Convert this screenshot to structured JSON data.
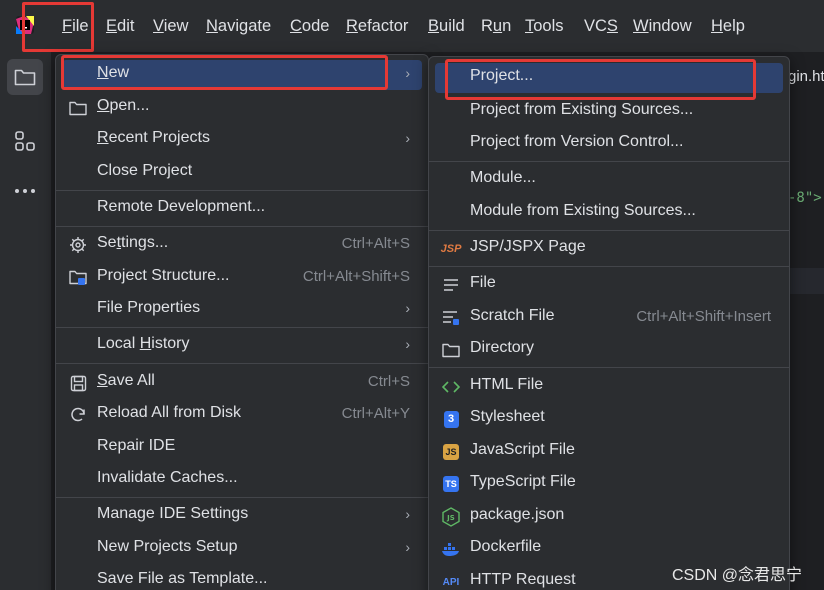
{
  "menubar": {
    "items": [
      {
        "pre": "",
        "mn": "F",
        "post": "ile"
      },
      {
        "pre": "",
        "mn": "E",
        "post": "dit"
      },
      {
        "pre": "",
        "mn": "V",
        "post": "iew"
      },
      {
        "pre": "",
        "mn": "N",
        "post": "avigate"
      },
      {
        "pre": "",
        "mn": "C",
        "post": "ode"
      },
      {
        "pre": "",
        "mn": "R",
        "post": "efactor"
      },
      {
        "pre": "",
        "mn": "B",
        "post": "uild"
      },
      {
        "pre": "R",
        "mn": "u",
        "post": "n"
      },
      {
        "pre": "",
        "mn": "T",
        "post": "ools"
      },
      {
        "pre": "VC",
        "mn": "S",
        "post": ""
      },
      {
        "pre": "",
        "mn": "W",
        "post": "indow"
      },
      {
        "pre": "",
        "mn": "H",
        "post": "elp"
      }
    ]
  },
  "file_menu": {
    "new": {
      "pre": "",
      "mn": "N",
      "post": "ew"
    },
    "open": {
      "pre": "",
      "mn": "O",
      "post": "pen..."
    },
    "recent_projects": {
      "pre": "",
      "mn": "R",
      "post": "ecent Projects"
    },
    "close_project": "Close Project",
    "remote_development": "Remote Development...",
    "settings": {
      "pre": "Se",
      "mn": "t",
      "post": "tings...",
      "shortcut": "Ctrl+Alt+S"
    },
    "project_structure": {
      "label": "Project Structure...",
      "shortcut": "Ctrl+Alt+Shift+S"
    },
    "file_properties": "File Properties",
    "local_history": {
      "pre": "Local ",
      "mn": "H",
      "post": "istory"
    },
    "save_all": {
      "pre": "",
      "mn": "S",
      "post": "ave All",
      "shortcut": "Ctrl+S"
    },
    "reload": {
      "label": "Reload All from Disk",
      "shortcut": "Ctrl+Alt+Y"
    },
    "repair_ide": "Repair IDE",
    "invalidate_caches": "Invalidate Caches...",
    "manage_ide_settings": "Manage IDE Settings",
    "new_projects_setup": "New Projects Setup",
    "save_as_template": "Save File as Template..."
  },
  "new_menu": {
    "project": "Project...",
    "project_existing_sources": "Project from Existing Sources...",
    "project_vcs": "Project from Version Control...",
    "module": "Module...",
    "module_existing_sources": "Module from Existing Sources...",
    "jsp_page": "JSP/JSPX Page",
    "file": "File",
    "scratch_file": {
      "label": "Scratch File",
      "shortcut": "Ctrl+Alt+Shift+Insert"
    },
    "directory": "Directory",
    "html_file": "HTML File",
    "stylesheet": "Stylesheet",
    "javascript_file": "JavaScript File",
    "typescript_file": "TypeScript File",
    "package_json": "package.json",
    "dockerfile": "Dockerfile",
    "http_request": "HTTP Request"
  },
  "editor": {
    "tab_text": "gin.ht",
    "code_fragment": "-8\">"
  },
  "icons": {
    "jsp": "JSP",
    "css": "3",
    "js": "JS",
    "ts": "TS",
    "package": "JS",
    "api": "API"
  },
  "watermark": "CSDN @念君思宁",
  "colors": {
    "highlight": "#2e436e",
    "annotation_red": "#e53935",
    "menu_bg": "#2b2d30"
  }
}
